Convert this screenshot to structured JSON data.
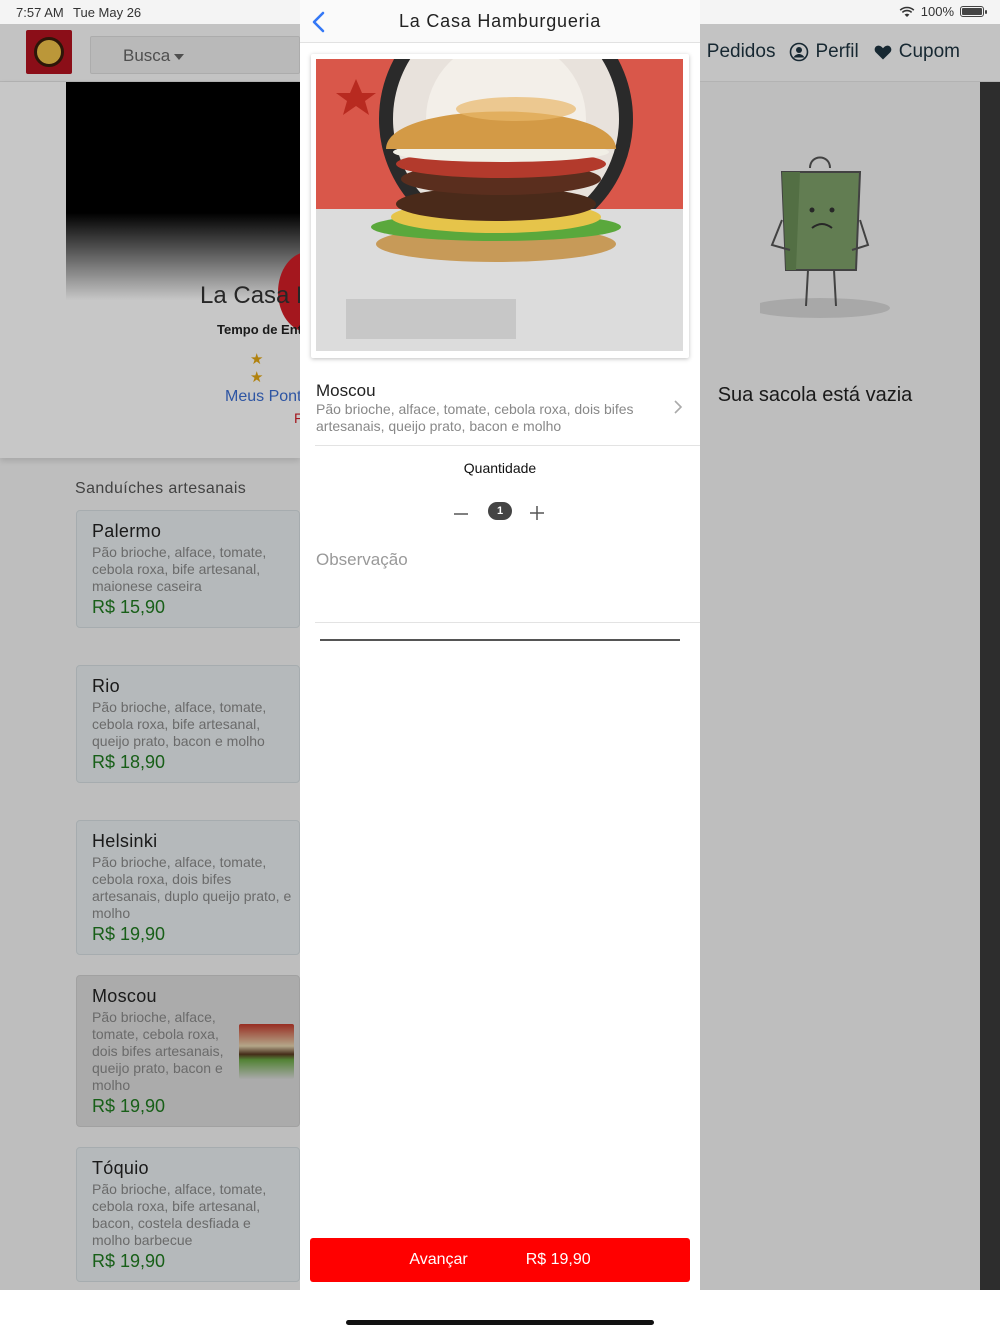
{
  "status_bar": {
    "time": "7:57 AM",
    "date": "Tue May 26",
    "battery": "100%"
  },
  "topnav": {
    "search_label": "Busca",
    "links": [
      {
        "label": "Pedidos",
        "icon": "receipt-icon"
      },
      {
        "label": "Perfil",
        "icon": "profile-icon"
      },
      {
        "label": "Cupom",
        "icon": "heart-icon"
      }
    ]
  },
  "restaurant": {
    "name_partial": "La Casa H",
    "eta_partial": "Tempo de Ent",
    "stars": "★ ★",
    "points_partial": "Meus Pont",
    "red_partial": "F"
  },
  "menu": {
    "section_title": "Sanduíches artesanais",
    "items": [
      {
        "name": "Palermo",
        "desc": "Pão brioche, alface, tomate, cebola roxa, bife artesanal, maionese caseira",
        "price": "R$ 15,90"
      },
      {
        "name": "Rio",
        "desc": "Pão brioche, alface, tomate, cebola roxa, bife artesanal, queijo prato, bacon e molho",
        "price": "R$ 18,90"
      },
      {
        "name": "Helsinki",
        "desc": "Pão brioche, alface, tomate, cebola roxa, dois bifes artesanais, duplo queijo prato, e molho",
        "price": "R$ 19,90"
      },
      {
        "name": "Moscou",
        "desc": "Pão brioche, alface, tomate, cebola roxa, dois bifes artesanais, queijo prato, bacon e molho",
        "price": "R$ 19,90"
      },
      {
        "name": "Tóquio",
        "desc": "Pão brioche, alface, tomate, cebola roxa, bife artesanal, bacon, costela desfiada e molho barbecue",
        "price": "R$ 19,90"
      }
    ]
  },
  "bag": {
    "empty_text": "Sua sacola está vazia"
  },
  "modal": {
    "title": "La Casa Hamburgueria",
    "product": {
      "name": "Moscou",
      "desc": "Pão brioche, alface, tomate, cebola roxa, dois bifes artesanais, queijo prato, bacon e molho"
    },
    "quantity_label": "Quantidade",
    "quantity": "1",
    "observation_placeholder": "Observação",
    "cta_label": "Avançar",
    "cta_price": "R$ 19,90"
  },
  "colors": {
    "cta": "#ff0000",
    "price": "#1f7a1f",
    "link": "#3b6ed1",
    "back": "#3478f6"
  }
}
